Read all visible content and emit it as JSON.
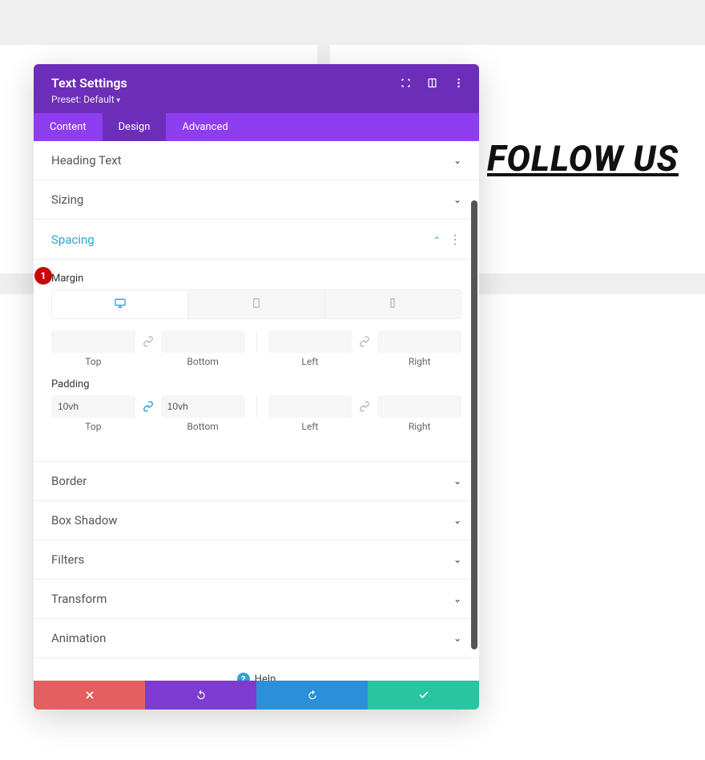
{
  "background": {
    "follow_text": "FOLLOW US"
  },
  "panel": {
    "title": "Text Settings",
    "preset": "Preset: Default",
    "tabs": {
      "content": "Content",
      "design": "Design",
      "advanced": "Advanced"
    }
  },
  "sections": {
    "heading_text": "Heading Text",
    "sizing": "Sizing",
    "spacing": "Spacing",
    "border": "Border",
    "box_shadow": "Box Shadow",
    "filters": "Filters",
    "transform": "Transform",
    "animation": "Animation"
  },
  "spacing": {
    "margin_label": "Margin",
    "padding_label": "Padding",
    "labels": {
      "top": "Top",
      "bottom": "Bottom",
      "left": "Left",
      "right": "Right"
    },
    "margin": {
      "top": "",
      "bottom": "",
      "left": "",
      "right": ""
    },
    "padding": {
      "top": "10vh",
      "bottom": "10vh",
      "left": "",
      "right": ""
    }
  },
  "help": "Help",
  "badge": "1"
}
